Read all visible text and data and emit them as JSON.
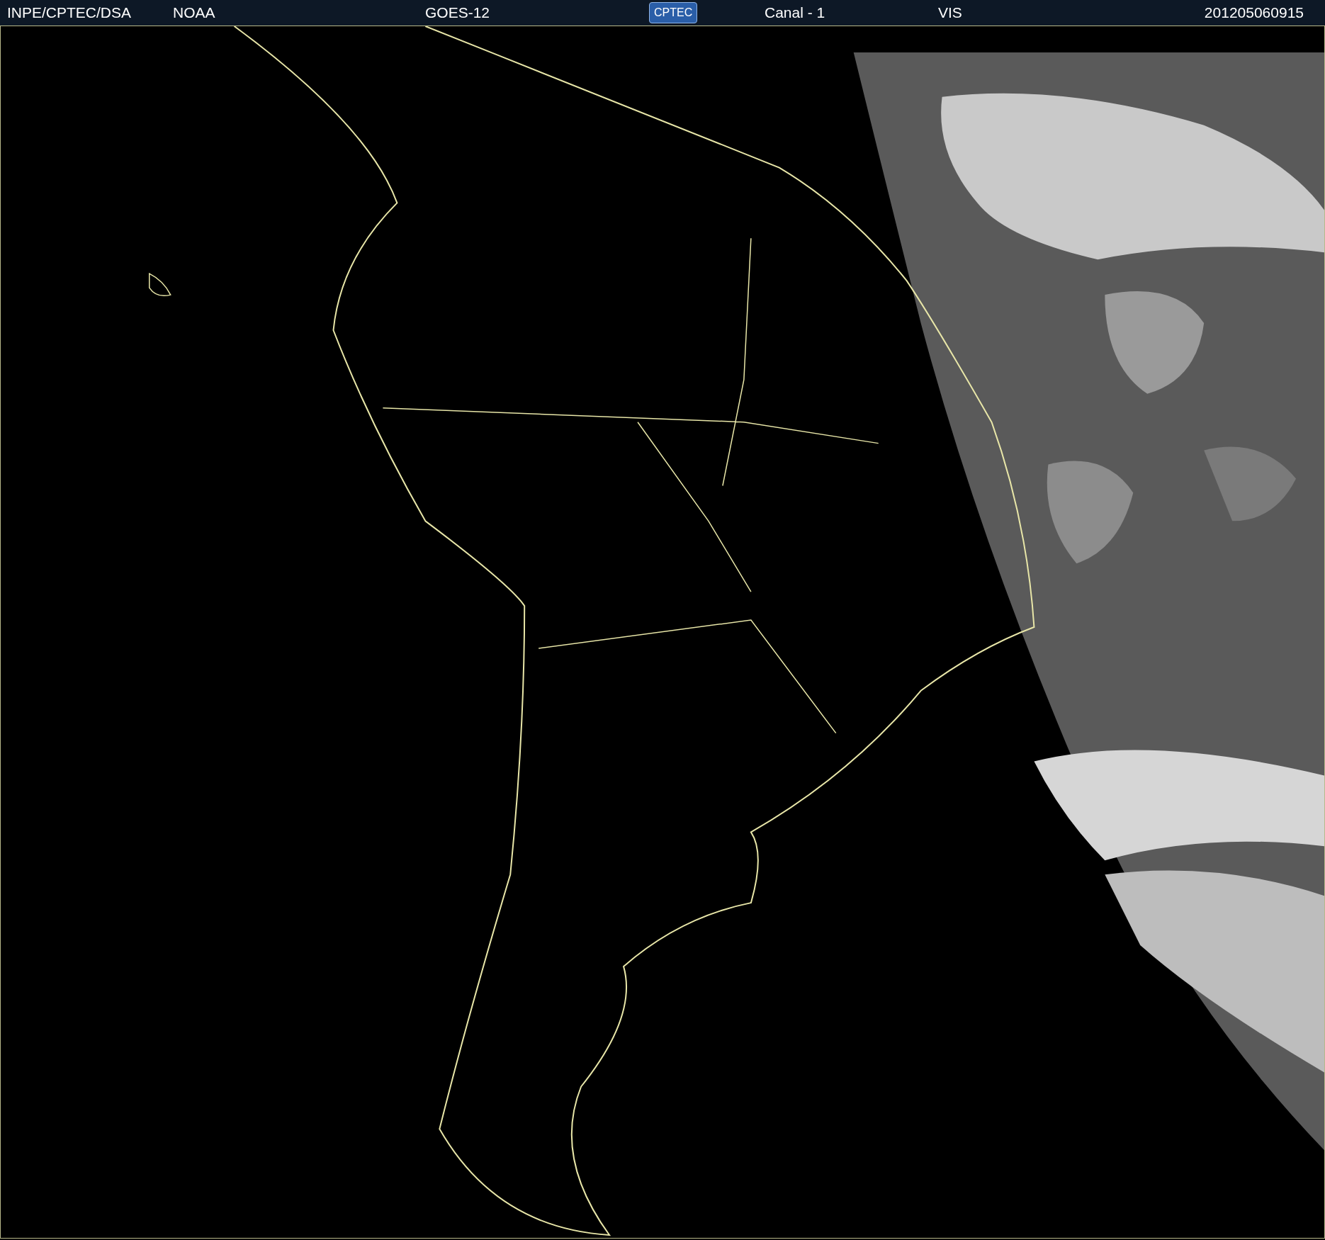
{
  "header": {
    "items": [
      {
        "kind": "text",
        "text": "INPE/CPTEC/DSA"
      },
      {
        "kind": "text",
        "text": "NOAA"
      },
      {
        "kind": "text",
        "text": "GOES-12"
      },
      {
        "kind": "logo",
        "text": "CPTEC"
      },
      {
        "kind": "text",
        "text": "Canal - 1"
      },
      {
        "kind": "text",
        "text": "VIS"
      },
      {
        "kind": "text",
        "text": "201205060915"
      }
    ]
  }
}
